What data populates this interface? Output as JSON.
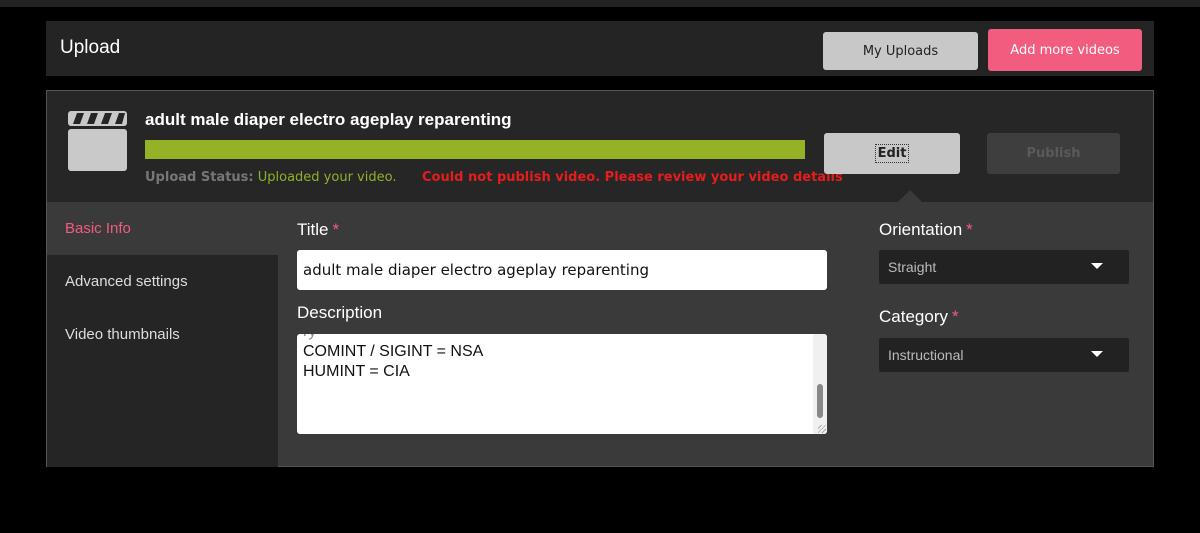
{
  "header": {
    "title": "Upload",
    "my_uploads_label": "My Uploads",
    "add_more_label": "Add more videos"
  },
  "upload": {
    "icon": "clapperboard-icon",
    "video_title": "adult male diaper electro ageplay reparenting",
    "progress_percent": 100,
    "status_label": "Upload Status:",
    "status_value": "Uploaded your video.",
    "error_message": "Could not publish video. Please review your video details",
    "edit_label": "Edit",
    "publish_label": "Publish"
  },
  "sidebar": {
    "items": [
      {
        "label": "Basic Info",
        "active": true
      },
      {
        "label": "Advanced settings",
        "active": false
      },
      {
        "label": "Video thumbnails",
        "active": false
      }
    ]
  },
  "form": {
    "title_label": "Title",
    "title_value": "adult male diaper electro ageplay reparenting",
    "description_label": "Description",
    "description_text": "COMINT / SIGINT = NSA\nHUMINT = CIA",
    "orientation_label": "Orientation",
    "orientation_value": "Straight",
    "category_label": "Category",
    "category_value": "Instructional",
    "required_mark": "*"
  },
  "colors": {
    "accent_pink": "#f15c7f",
    "progress_green": "#93b225",
    "error_red": "#e61d1d"
  }
}
